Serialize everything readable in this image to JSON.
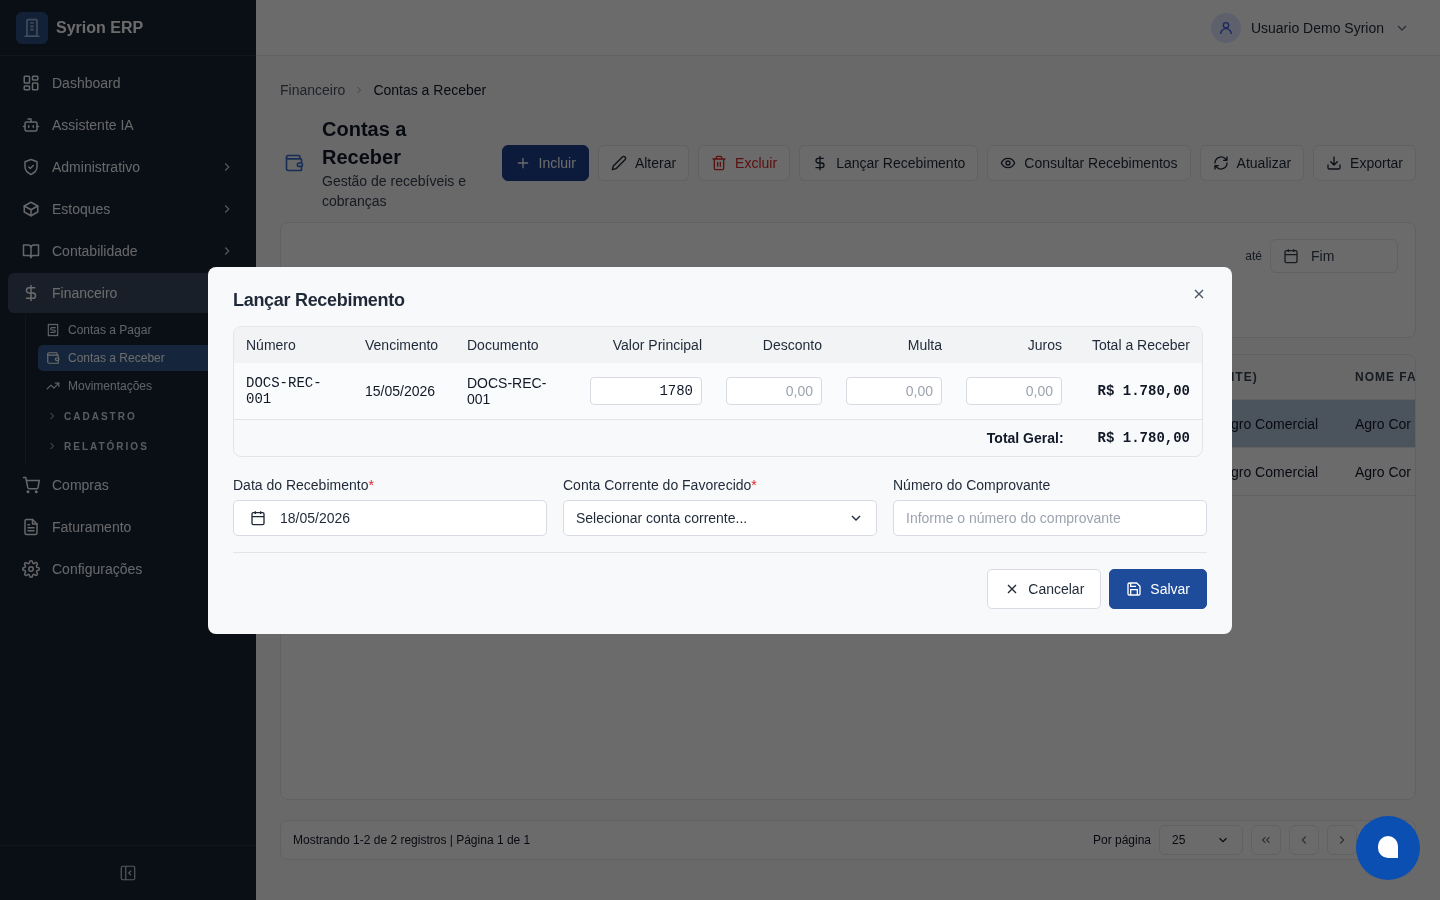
{
  "app": {
    "name": "Syrion ERP"
  },
  "user": {
    "name": "Usuario Demo Syrion"
  },
  "sidebar": {
    "items": [
      {
        "label": "Dashboard",
        "selected": false
      },
      {
        "label": "Assistente IA",
        "selected": false
      },
      {
        "label": "Administrativo",
        "selected": false,
        "expanded": false
      },
      {
        "label": "Estoques",
        "selected": false,
        "expanded": false
      },
      {
        "label": "Contabilidade",
        "selected": false,
        "expanded": false
      },
      {
        "label": "Financeiro",
        "selected": true,
        "expanded": true,
        "children": [
          {
            "kind": "item",
            "label": "Contas a Pagar",
            "selected": false
          },
          {
            "kind": "item",
            "label": "Contas a Receber",
            "selected": true
          },
          {
            "kind": "item",
            "label": "Movimentações",
            "selected": false
          },
          {
            "kind": "section",
            "label": "CADASTRO",
            "expanded": false
          },
          {
            "kind": "section",
            "label": "RELATÓRIOS",
            "expanded": false
          }
        ]
      },
      {
        "label": "Compras",
        "selected": false
      },
      {
        "label": "Faturamento",
        "selected": false
      },
      {
        "label": "Configurações",
        "selected": false
      }
    ]
  },
  "breadcrumb": [
    "Financeiro",
    "Contas a Receber"
  ],
  "page": {
    "title": "Contas a Receber",
    "subtitle": "Gestão de recebíveis e cobranças"
  },
  "toolbar": [
    {
      "label": "Incluir",
      "kind": "primary"
    },
    {
      "label": "Alterar",
      "kind": "default"
    },
    {
      "label": "Excluir",
      "kind": "danger"
    },
    {
      "label": "Lançar Recebimento",
      "kind": "default"
    },
    {
      "label": "Consultar Recebimentos",
      "kind": "default"
    },
    {
      "label": "Atualizar",
      "kind": "default"
    },
    {
      "label": "Exportar",
      "kind": "default"
    }
  ],
  "filters": {
    "range_separator": "até",
    "end_placeholder": "Fim"
  },
  "table": {
    "columns": [
      "ITE)",
      "NOME FA"
    ],
    "rows": [
      {
        "cells": [
          "gro Comercial",
          "Agro Cor"
        ],
        "selected": true
      },
      {
        "cells": [
          "gro Comercial",
          "Agro Cor"
        ],
        "selected": false
      }
    ]
  },
  "pagination": {
    "summary": "Mostrando 1-2 de 2 registros | Página 1 de 1",
    "per_page_label": "Por página",
    "per_page": "25"
  },
  "dialog": {
    "title": "Lançar Recebimento",
    "columns": [
      "Número",
      "Vencimento",
      "Documento",
      "Valor Principal",
      "Desconto",
      "Multa",
      "Juros",
      "Total a Receber"
    ],
    "row": {
      "numero": "DOCS-REC-001",
      "vencimento": "15/05/2026",
      "documento": "DOCS-REC-001",
      "valor_principal": {
        "value": "1780"
      },
      "desconto": {
        "placeholder": "0,00"
      },
      "multa": {
        "placeholder": "0,00"
      },
      "juros": {
        "placeholder": "0,00"
      },
      "total": "R$ 1.780,00"
    },
    "total_label": "Total Geral:",
    "total": "R$ 1.780,00",
    "fields": [
      {
        "kind": "date",
        "label": "Data do Recebimento",
        "required_marker": "*",
        "value": "18/05/2026"
      },
      {
        "kind": "select",
        "label": "Conta Corrente do Favorecido",
        "required_marker": "*",
        "value": "Selecionar conta corrente..."
      },
      {
        "kind": "text",
        "label": "Número do Comprovante",
        "placeholder": "Informe o número do comprovante"
      }
    ],
    "buttons": [
      {
        "label": "Cancelar",
        "kind": "secondary"
      },
      {
        "label": "Salvar",
        "kind": "primary"
      }
    ]
  }
}
